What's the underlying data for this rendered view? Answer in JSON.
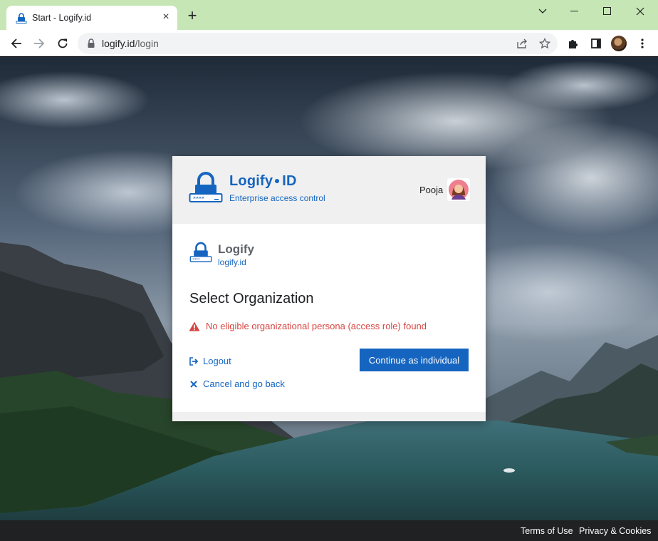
{
  "browser": {
    "tab_title": "Start - Logify.id",
    "new_tab": "+",
    "url_host": "logify.id",
    "url_path": "/login"
  },
  "header": {
    "brand_name": "Logify",
    "brand_suffix": "ID",
    "tagline": "Enterprise access control",
    "user_name": "Pooja"
  },
  "org": {
    "name": "Logify",
    "domain": "logify.id"
  },
  "main": {
    "title": "Select Organization",
    "error": "No eligible organizational persona (access role) found",
    "logout_label": "Logout",
    "continue_label": "Continue as individual",
    "cancel_label": "Cancel and go back"
  },
  "footer": {
    "terms": "Terms of Use",
    "privacy": "Privacy & Cookies"
  },
  "colors": {
    "brand": "#1565c0",
    "error": "#d64541",
    "titlebar": "#c6e7b5"
  }
}
